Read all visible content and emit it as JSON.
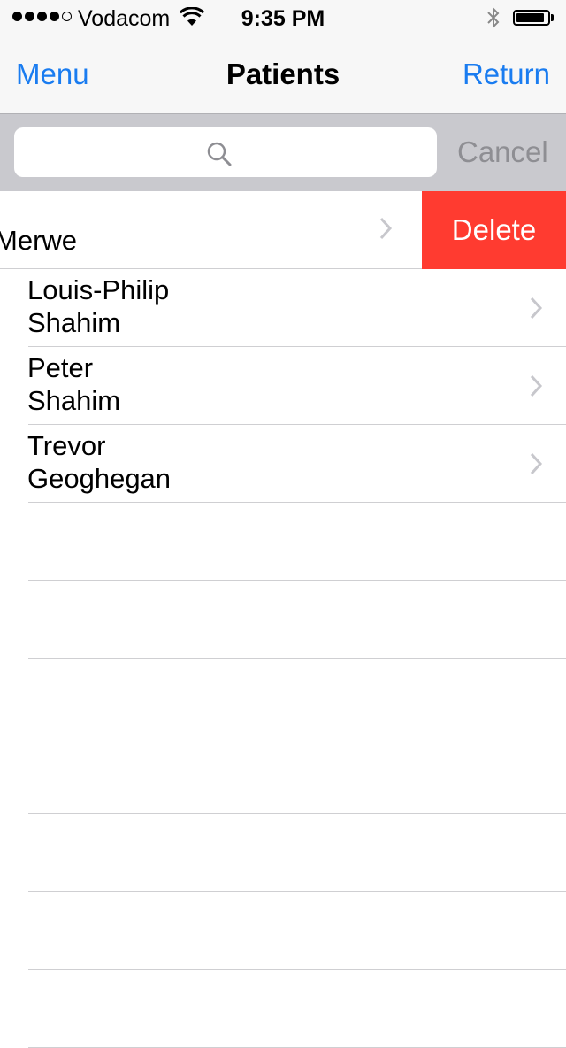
{
  "status_bar": {
    "carrier": "Vodacom",
    "time": "9:35 PM",
    "signal_bars_filled": 4,
    "signal_bars_total": 5,
    "battery_level": 0.9
  },
  "nav": {
    "left_label": "Menu",
    "title": "Patients",
    "right_label": "Return"
  },
  "search": {
    "placeholder": "",
    "cancel_label": "Cancel"
  },
  "patients": [
    {
      "first": "",
      "last": "Merwe",
      "delete_label": "Delete"
    },
    {
      "first": "Louis-Philip",
      "last": "Shahim"
    },
    {
      "first": "Peter",
      "last": "Shahim"
    },
    {
      "first": "Trevor",
      "last": "Geoghegan"
    }
  ],
  "colors": {
    "accent": "#1a7cf0",
    "delete": "#ff3b30",
    "search_bar": "#c9c9ce",
    "cancel": "#8e8e93"
  }
}
